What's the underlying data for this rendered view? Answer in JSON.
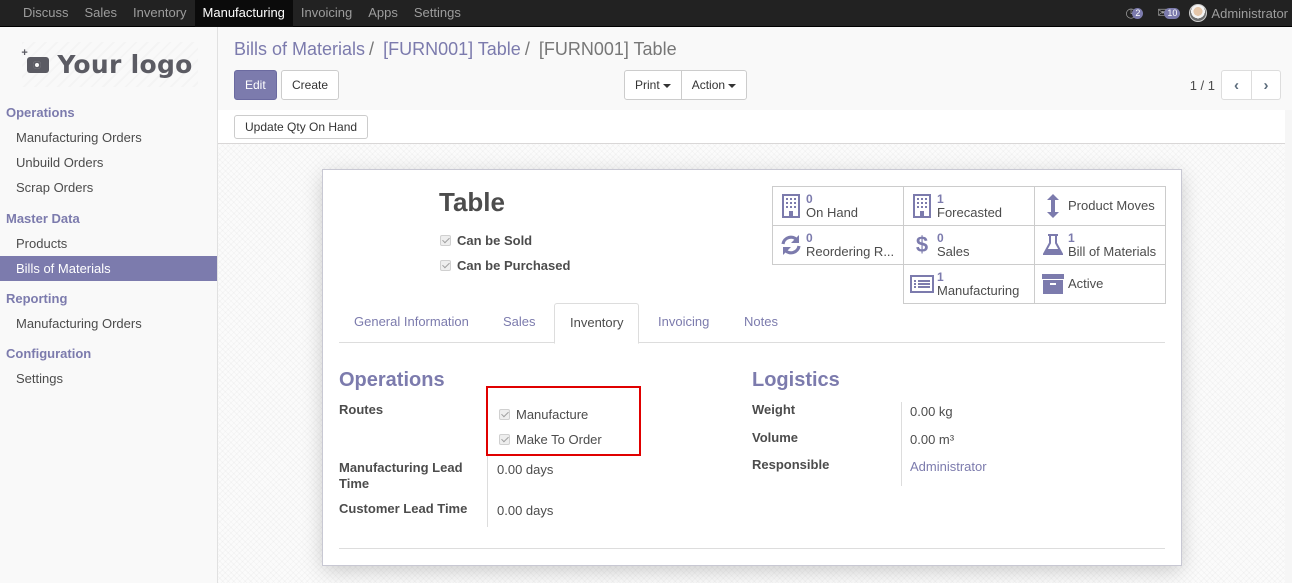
{
  "topbar": {
    "menu": [
      "Discuss",
      "Sales",
      "Inventory",
      "Manufacturing",
      "Invoicing",
      "Apps",
      "Settings"
    ],
    "active_menu": "Manufacturing",
    "activity_count": "2",
    "messages_count": "10",
    "user_name": "Administrator"
  },
  "sidebar": {
    "logo_text": "Your logo",
    "sections": [
      {
        "title": "Operations",
        "items": [
          "Manufacturing Orders",
          "Unbuild Orders",
          "Scrap Orders"
        ]
      },
      {
        "title": "Master Data",
        "items": [
          "Products",
          "Bills of Materials"
        ]
      },
      {
        "title": "Reporting",
        "items": [
          "Manufacturing Orders"
        ]
      },
      {
        "title": "Configuration",
        "items": [
          "Settings"
        ]
      }
    ],
    "active_item": "Bills of Materials"
  },
  "control_panel": {
    "breadcrumb": [
      "Bills of Materials",
      "[FURN001] Table",
      "[FURN001] Table"
    ],
    "separator": "/",
    "edit_label": "Edit",
    "create_label": "Create",
    "print_label": "Print",
    "action_label": "Action",
    "pager_value": "1 / 1"
  },
  "statusbar": {
    "update_qty_label": "Update Qty On Hand"
  },
  "product": {
    "name": "Table",
    "can_be_sold_label": "Can be Sold",
    "can_be_sold": true,
    "can_be_purchased_label": "Can be Purchased",
    "can_be_purchased": true
  },
  "smart_buttons": [
    {
      "icon": "building-icon",
      "value": "0",
      "label": "On Hand"
    },
    {
      "icon": "building-icon",
      "value": "1",
      "label": "Forecasted"
    },
    {
      "icon": "arrows-v-icon",
      "value": "",
      "label": "Product Moves"
    },
    {
      "icon": "refresh-icon",
      "value": "0",
      "label": "Reordering R..."
    },
    {
      "icon": "dollar-icon",
      "value": "0",
      "label": "Sales"
    },
    {
      "icon": "flask-icon",
      "value": "1",
      "label": "Bill of Materials"
    },
    {
      "icon": "list-icon",
      "value": "1",
      "label": "Manufacturing"
    },
    {
      "icon": "archive-icon",
      "value": "",
      "label": "Active"
    }
  ],
  "tabs": [
    "General Information",
    "Sales",
    "Inventory",
    "Invoicing",
    "Notes"
  ],
  "active_tab": "Inventory",
  "operations": {
    "title": "Operations",
    "routes_label": "Routes",
    "routes": [
      {
        "label": "Manufacture",
        "checked": true
      },
      {
        "label": "Make To Order",
        "checked": true
      }
    ],
    "mfg_lead_label_1": "Manufacturing Lead",
    "mfg_lead_label_2": "Time",
    "mfg_lead_value": "0.00 days",
    "customer_lead_label": "Customer Lead Time",
    "customer_lead_value": "0.00 days"
  },
  "logistics": {
    "title": "Logistics",
    "weight_label": "Weight",
    "weight_value": "0.00 kg",
    "volume_label": "Volume",
    "volume_value": "0.00 m³",
    "responsible_label": "Responsible",
    "responsible_value": "Administrator"
  },
  "colors": {
    "brand": "#7c7bad",
    "topbar": "#222222",
    "highlight": "#e00000"
  }
}
